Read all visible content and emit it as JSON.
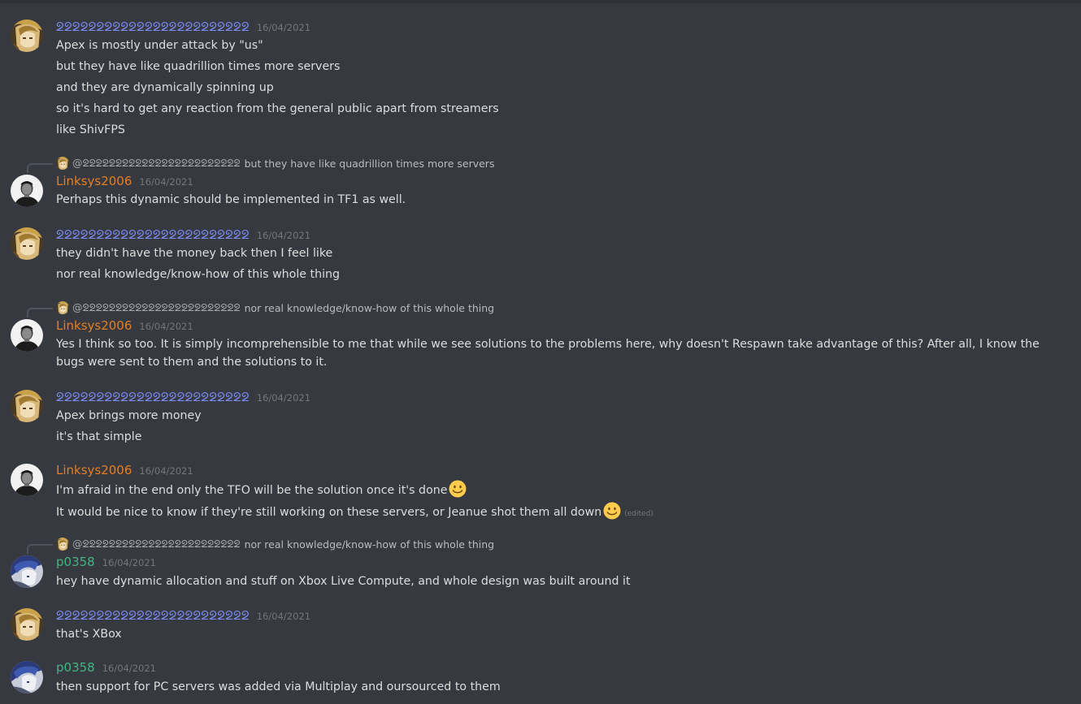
{
  "users": {
    "sym": "ᘖᘖᘖᘖᘖᘖᘖᘖᘖᘖᘖᘖᘖᘖᘖᘖᘖᘖᘖᘖᘖᘖᘖᘖ",
    "linksys": "Linksys2006",
    "p0358": "p0358"
  },
  "colors": {
    "background": "#36393f",
    "username_sym": "#7d8cf5",
    "username_linksys": "#e67e22",
    "username_p0358": "#43b581"
  },
  "messages": [
    {
      "author": "ᘖᘖᘖᘖᘖᘖᘖᘖᘖᘖᘖᘖᘖᘖᘖᘖᘖᘖᘖᘖᘖᘖᘖᘖ",
      "timestamp": "16/04/2021",
      "lines": [
        "Apex is mostly under attack by \"us\"",
        "but they have like quadrillion times more servers",
        "and they are dynamically spinning up",
        "so it's hard to get any reaction from the general public apart from streamers",
        "like ShivFPS"
      ]
    },
    {
      "reply_to": "@ᘖᘖᘖᘖᘖᘖᘖᘖᘖᘖᘖᘖᘖᘖᘖᘖᘖᘖᘖᘖᘖᘖᘖᘖ",
      "reply_text": "but they have like quadrillion times more servers",
      "author": "Linksys2006",
      "timestamp": "16/04/2021",
      "lines": [
        "Perhaps this dynamic should be implemented in TF1 as well."
      ]
    },
    {
      "author": "ᘖᘖᘖᘖᘖᘖᘖᘖᘖᘖᘖᘖᘖᘖᘖᘖᘖᘖᘖᘖᘖᘖᘖᘖ",
      "timestamp": "16/04/2021",
      "lines": [
        "they didn't have the money back then I feel like",
        "nor real knowledge/know-how of this whole thing"
      ]
    },
    {
      "reply_to": "@ᘖᘖᘖᘖᘖᘖᘖᘖᘖᘖᘖᘖᘖᘖᘖᘖᘖᘖᘖᘖᘖᘖᘖᘖ",
      "reply_text": "nor real knowledge/know-how of this whole thing",
      "author": "Linksys2006",
      "timestamp": "16/04/2021",
      "lines": [
        "Yes I think so too. It is simply incomprehensible to me that while we see solutions to the problems here, why doesn't Respawn take advantage of this? After all, I know the bugs were sent to them and the solutions to it."
      ]
    },
    {
      "author": "ᘖᘖᘖᘖᘖᘖᘖᘖᘖᘖᘖᘖᘖᘖᘖᘖᘖᘖᘖᘖᘖᘖᘖᘖ",
      "timestamp": "16/04/2021",
      "lines": [
        "Apex brings more money",
        "it's that simple"
      ]
    },
    {
      "author": "Linksys2006",
      "timestamp": "16/04/2021",
      "lines": [
        "I'm afraid in the end only the TFO will be the solution once it's done",
        "It would be nice to know if they're still working on these servers, or Jeanue shot them all down"
      ],
      "edited_label": "(edited)"
    },
    {
      "reply_to": "@ᘖᘖᘖᘖᘖᘖᘖᘖᘖᘖᘖᘖᘖᘖᘖᘖᘖᘖᘖᘖᘖᘖᘖᘖ",
      "reply_text": "nor real knowledge/know-how of this whole thing",
      "author": "p0358",
      "timestamp": "16/04/2021",
      "lines": [
        "hey have dynamic allocation and stuff on Xbox Live Compute, and whole design was built around it"
      ]
    },
    {
      "author": "ᘖᘖᘖᘖᘖᘖᘖᘖᘖᘖᘖᘖᘖᘖᘖᘖᘖᘖᘖᘖᘖᘖᘖᘖ",
      "timestamp": "16/04/2021",
      "lines": [
        "that's XBox"
      ]
    },
    {
      "author": "p0358",
      "timestamp": "16/04/2021",
      "lines": [
        "then support for PC servers was added via Multiplay and oursourced to them"
      ]
    }
  ]
}
